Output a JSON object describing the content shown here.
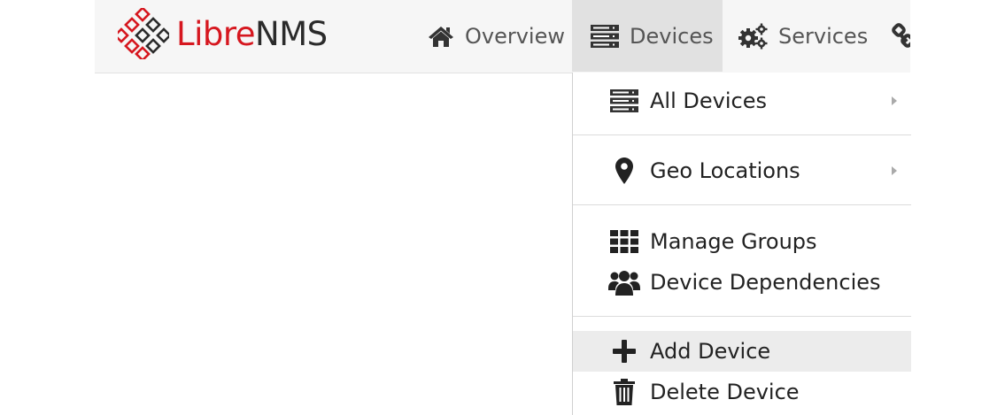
{
  "app": {
    "logo_text_red": "Libre",
    "logo_text_dark": "NMS",
    "brand_color": "#d6171f"
  },
  "navbar": {
    "items": [
      {
        "label": "Overview",
        "icon": "home-icon"
      },
      {
        "label": "Devices",
        "icon": "server-icon",
        "active": true
      },
      {
        "label": "Services",
        "icon": "cogs-icon"
      },
      {
        "label": "",
        "icon": "plug-icon"
      }
    ]
  },
  "devices_menu": {
    "items": [
      {
        "label": "All Devices",
        "icon": "server-icon",
        "has_submenu": true
      },
      {
        "label": "Geo Locations",
        "icon": "map-marker-icon",
        "has_submenu": true
      },
      {
        "label": "Manage Groups",
        "icon": "grid-icon"
      },
      {
        "label": "Device Dependencies",
        "icon": "users-icon"
      },
      {
        "label": "Add Device",
        "icon": "plus-icon",
        "highlighted": true
      },
      {
        "label": "Delete Device",
        "icon": "trash-icon"
      }
    ]
  }
}
